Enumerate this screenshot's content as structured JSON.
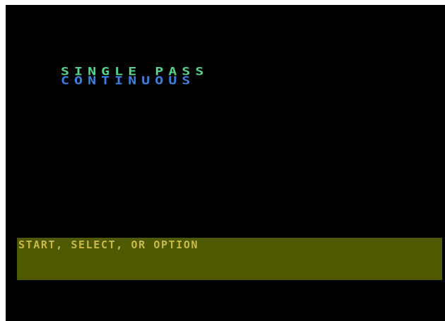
{
  "screen": {
    "background": "#000000"
  },
  "menu": {
    "items": [
      {
        "label": "SINGLE PASS",
        "color": "#58d38a"
      },
      {
        "label": "CONTINUOUS",
        "color": "#3d7fe0"
      }
    ]
  },
  "prompt": {
    "text": "START, SELECT, OR OPTION",
    "text_color": "#c9b94a",
    "bar_color": "#4f5a00"
  }
}
